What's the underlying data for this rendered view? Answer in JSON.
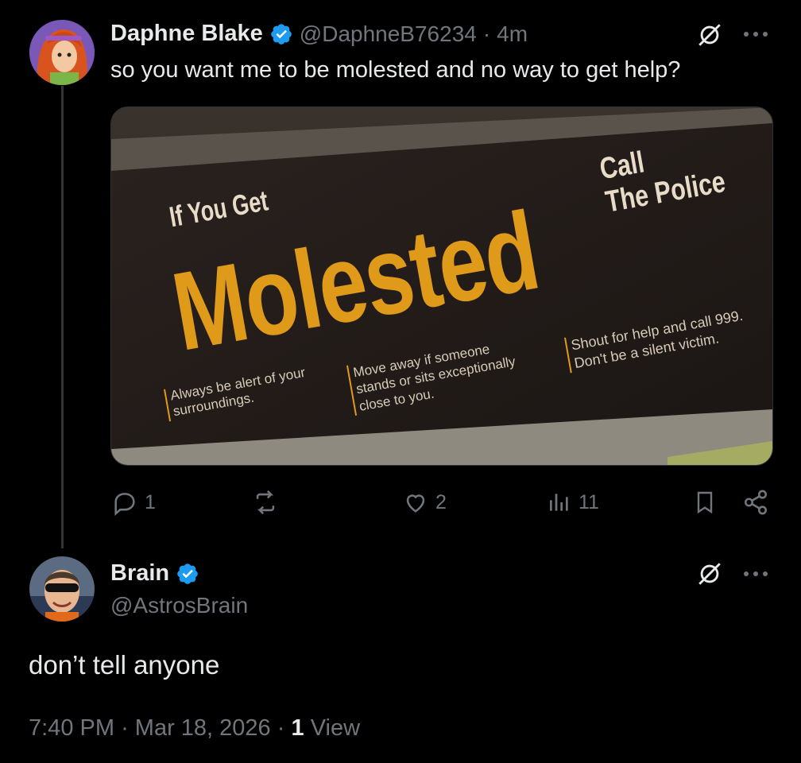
{
  "tweet": {
    "author_name": "Daphne Blake",
    "handle": "@DaphneB76234",
    "time": "4m",
    "text": "so you want me to be molested and no way to get help?",
    "image": {
      "line_if": "If You Get",
      "line_big": "Molested",
      "line_call": "Call",
      "line_police": "The Police",
      "tip1_a": "Always be alert of your",
      "tip1_b": "surroundings.",
      "tip2_a": "Move away if someone",
      "tip2_b": "stands or sits exceptionally",
      "tip2_c": "close to you.",
      "tip3_a": "Shout for help and call 999.",
      "tip3_b": "Don't be a silent victim."
    },
    "stats": {
      "replies": "1",
      "reposts": "",
      "likes": "2",
      "views": "11"
    }
  },
  "reply": {
    "author_name": "Brain",
    "handle": "@AstrosBrain",
    "text": "don’t tell anyone",
    "time": "7:40 PM",
    "date": "Mar 18, 2026",
    "views_count": "1",
    "views_label": "View"
  },
  "colors": {
    "background": "#000000",
    "text": "#e7e9ea",
    "muted": "#71767b",
    "verified": "#1d9bf0",
    "sign_yellow": "#e09a1a"
  },
  "icons": [
    "verified-badge-icon",
    "grok-icon",
    "more-icon",
    "reply-icon",
    "repost-icon",
    "like-icon",
    "views-icon",
    "bookmark-icon",
    "share-icon"
  ]
}
